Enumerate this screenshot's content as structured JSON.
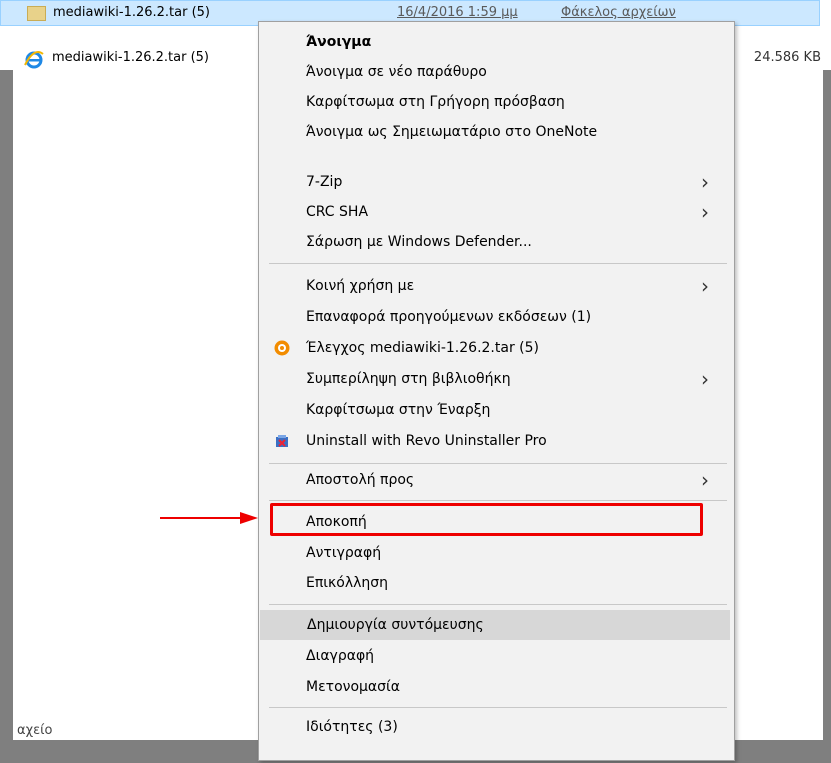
{
  "explorer": {
    "row1": {
      "name": "mediawiki-1.26.2.tar (5)",
      "date": "16/4/2016 1:59 μμ",
      "type": "Φάκελος αρχείων"
    },
    "row2": {
      "name": "mediawiki-1.26.2.tar (5)",
      "size": "24.586 KB"
    },
    "status_fragment": "αχείο"
  },
  "menu": {
    "items": [
      {
        "label": "Άνοιγμα",
        "bold": true
      },
      {
        "label": "Άνοιγμα σε νέο παράθυρο"
      },
      {
        "label": "Καρφίτσωμα στη Γρήγορη πρόσβαση"
      },
      {
        "label": "Άνοιγμα ως Σημειωματάριο στο OneNote"
      },
      {
        "label": "7-Zip",
        "submenu": true
      },
      {
        "label": "CRC SHA",
        "submenu": true
      },
      {
        "label": "Σάρωση με Windows Defender..."
      },
      {
        "label": "Κοινή χρήση με",
        "submenu": true
      },
      {
        "label": "Επαναφορά προηγούμενων εκδόσεων (1)"
      },
      {
        "label": "Έλεγχος mediawiki-1.26.2.tar (5)",
        "icon": "avast-icon"
      },
      {
        "label": "Συμπερίληψη στη βιβλιοθήκη",
        "submenu": true
      },
      {
        "label": "Καρφίτσωμα στην Έναρξη"
      },
      {
        "label": "Uninstall with Revo Uninstaller Pro",
        "icon": "revo-uninstaller-icon"
      },
      {
        "label": "Αποστολή προς",
        "submenu": true
      },
      {
        "label": "Αποκοπή"
      },
      {
        "label": "Αντιγραφή"
      },
      {
        "label": "Επικόλληση"
      },
      {
        "label": "Δημιουργία συντόμευσης",
        "hover": true
      },
      {
        "label": "Διαγραφή"
      },
      {
        "label": "Μετονομασία"
      },
      {
        "label": "Ιδιότητες (3)"
      }
    ],
    "submenu_glyph": "›"
  },
  "annotation": {
    "color": "#e00000",
    "target": "Αποκοπή"
  },
  "colors": {
    "selection": "#cce8ff",
    "menu_bg": "#f2f2f2",
    "hover": "#d7d7d7"
  }
}
